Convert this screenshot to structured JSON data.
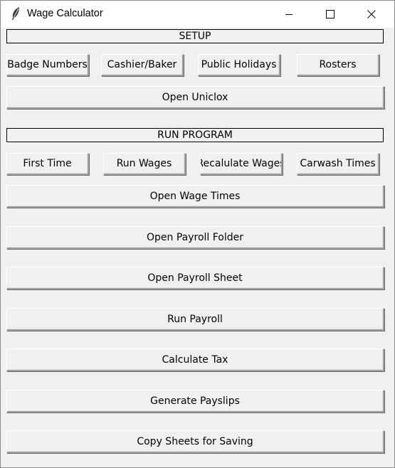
{
  "window": {
    "title": "Wage Calculator",
    "app_icon": "feather-icon",
    "controls": [
      "minimize-icon",
      "maximize-icon",
      "close-icon"
    ]
  },
  "setup": {
    "header": "SETUP",
    "buttons": [
      "Badge Numbers",
      "Cashier/Baker",
      "Public Holidays",
      "Rosters"
    ],
    "open_uniclox": "Open Uniclox"
  },
  "run_program": {
    "header": "RUN PROGRAM",
    "buttons": [
      "First Time",
      "Run Wages",
      "Recalulate Wages",
      "Carwash Times"
    ],
    "actions": [
      "Open Wage Times",
      "Open Payroll Folder",
      "Open Payroll Sheet",
      "Run Payroll",
      "Calculate Tax",
      "Generate Payslips",
      "Copy Sheets for Saving"
    ]
  }
}
